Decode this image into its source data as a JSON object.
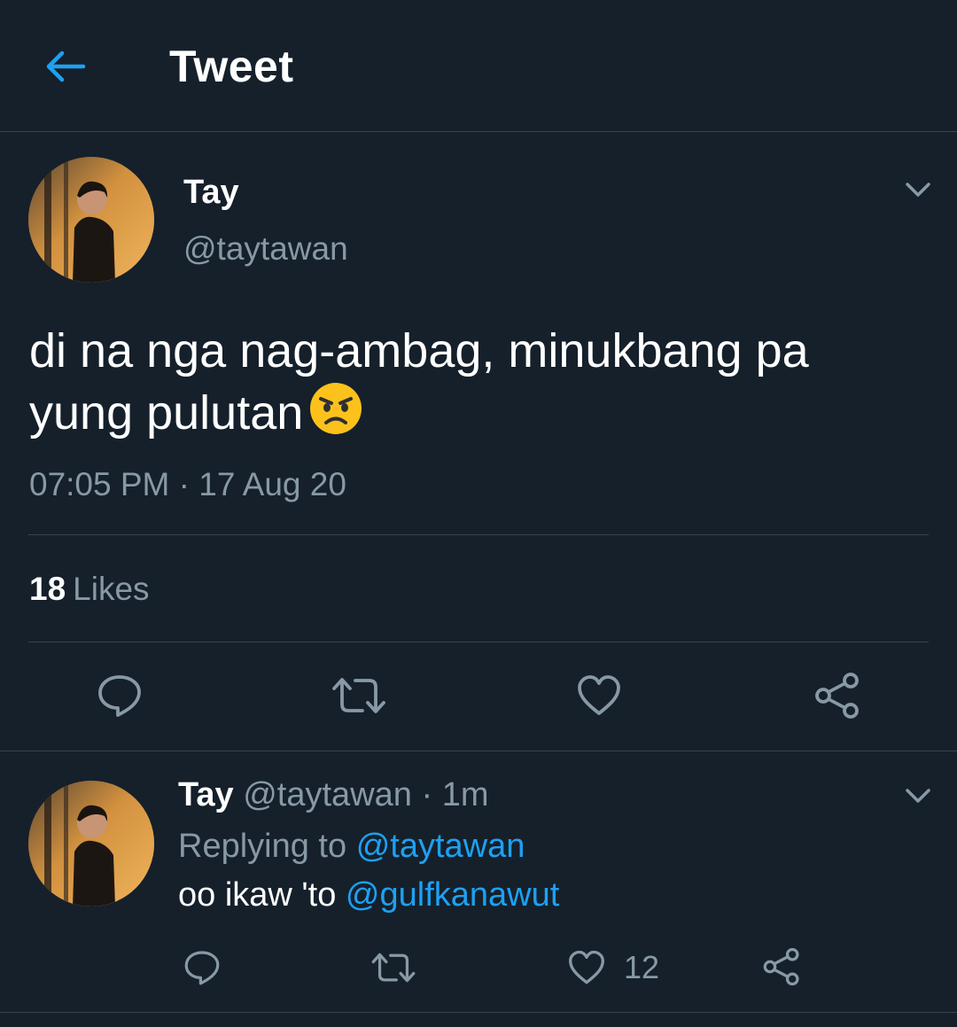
{
  "header": {
    "title": "Tweet",
    "back_icon": "back-arrow-icon",
    "accent_color": "#1da1f2"
  },
  "tweet": {
    "author_name": "Tay",
    "author_handle": "@taytawan",
    "text": "di na nga nag-ambag, minukbang pa yung pulutan",
    "emoji": "angry-face-emoji",
    "timestamp": "07:05 PM · 17 Aug 20",
    "likes_count": "18",
    "likes_label": "Likes",
    "actions": [
      "reply-icon",
      "retweet-icon",
      "like-icon",
      "share-icon"
    ]
  },
  "reply": {
    "author_name": "Tay",
    "author_handle": "@taytawan",
    "separator": "·",
    "time": "1m",
    "replying_to_label": "Replying to",
    "replying_to_handle": "@taytawan",
    "text": "oo ikaw 'to",
    "mention": "@gulfkanawut",
    "like_count": "12",
    "actions": [
      "reply-icon",
      "retweet-icon",
      "like-icon",
      "share-icon"
    ]
  },
  "colors": {
    "background": "#15202b",
    "divider": "#38444d",
    "secondary_text": "#8899a6",
    "link": "#1da1f2"
  }
}
